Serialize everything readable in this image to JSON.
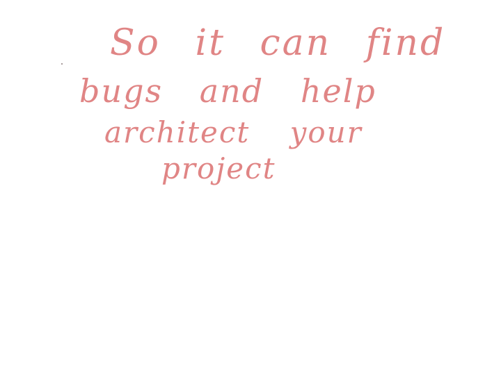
{
  "handwriting": {
    "ink_color": "#e08585",
    "lines": [
      "So it can find",
      "bugs and help",
      "architect your",
      "project"
    ]
  }
}
